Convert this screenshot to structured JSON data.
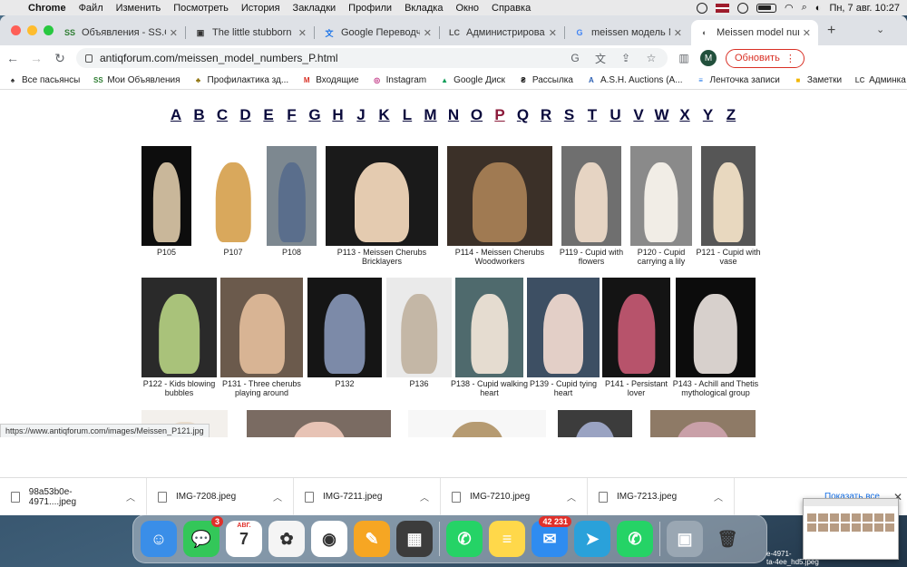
{
  "menubar": {
    "app": "Chrome",
    "items": [
      "Файл",
      "Изменить",
      "Посмотреть",
      "История",
      "Закладки",
      "Профили",
      "Вкладка",
      "Окно",
      "Справка"
    ],
    "clock": "Пн, 7 авг.  10:27"
  },
  "tabs": [
    {
      "icon": "SS",
      "label": "Объявления - SS.COM",
      "color": "#2e7d32"
    },
    {
      "icon": "▣",
      "label": "The little stubborn one,",
      "color": "#333"
    },
    {
      "icon": "文",
      "label": "Google Переводчик",
      "color": "#1a73e8"
    },
    {
      "icon": "LC",
      "label": "Администрирование С",
      "color": "#555"
    },
    {
      "icon": "G",
      "label": "meissen модель № Р 1",
      "color": "#4285f4"
    },
    {
      "icon": "◐",
      "label": "Meissen model number",
      "color": "#555"
    }
  ],
  "toolbar": {
    "url": "antiqforum.com/meissen_model_numbers_P.html",
    "profile_initial": "M",
    "update_label": "Обновить"
  },
  "bookmarks": [
    {
      "icon": "♠",
      "label": "Все пасьянсы",
      "color": "#222"
    },
    {
      "icon": "SS",
      "label": "Мои Объявления",
      "color": "#2e7d32"
    },
    {
      "icon": "♣",
      "label": "Профилактика зд...",
      "color": "#8a6d00"
    },
    {
      "icon": "M",
      "label": "Входящие",
      "color": "#d93025"
    },
    {
      "icon": "◎",
      "label": "Instagram",
      "color": "#c13584"
    },
    {
      "icon": "▲",
      "label": "Google Диск",
      "color": "#0f9d58"
    },
    {
      "icon": "₴",
      "label": "Рассылка",
      "color": "#111"
    },
    {
      "icon": "A",
      "label": "A.S.H. Auctions (A...",
      "color": "#2b5fb3"
    },
    {
      "icon": "≡",
      "label": "Ленточка записи",
      "color": "#1a73e8"
    },
    {
      "icon": "■",
      "label": "Заметки",
      "color": "#f2b600"
    },
    {
      "icon": "LC",
      "label": "Админка",
      "color": "#555"
    }
  ],
  "letters": [
    "A",
    "B",
    "C",
    "D",
    "E",
    "F",
    "G",
    "H",
    "J",
    "K",
    "L",
    "M",
    "N",
    "O",
    "P",
    "Q",
    "R",
    "S",
    "T",
    "U",
    "V",
    "W",
    "X",
    "Y",
    "Z"
  ],
  "current_letter": "P",
  "rows": [
    [
      {
        "caption": "P105",
        "bg": "#0d0d0d",
        "fig": "#c9b79a"
      },
      {
        "caption": "P107",
        "bg": "#ffffff",
        "fig": "#d9a85c"
      },
      {
        "caption": "P108",
        "bg": "#7d8890",
        "fig": "#5a6e8c"
      },
      {
        "caption": "P113 - Meissen Cherubs Bricklayers",
        "bg": "#1a1a1a",
        "fig": "#e4cbb0"
      },
      {
        "caption": "P114 - Meissen Cherubs Woodworkers",
        "bg": "#3b3028",
        "fig": "#a07a52"
      },
      {
        "caption": "P119 - Cupid with flowers",
        "bg": "#6f6f6f",
        "fig": "#e6d4c3"
      },
      {
        "caption": "P120 - Cupid carrying a lily",
        "bg": "#8a8a8a",
        "fig": "#f1ede6"
      },
      {
        "caption": "P121 - Cupid with vase",
        "bg": "#565656",
        "fig": "#e8d8bf"
      }
    ],
    [
      {
        "caption": "P122 - Kids blowing bubbles",
        "bg": "#2a2a2a",
        "fig": "#a9c27a"
      },
      {
        "caption": "P131 - Three cherubs playing around",
        "bg": "#6b5a4c",
        "fig": "#d8b494"
      },
      {
        "caption": "P132",
        "bg": "#151515",
        "fig": "#7c8aa8"
      },
      {
        "caption": "P136",
        "bg": "#eaeaea",
        "fig": "#c4b7a6"
      },
      {
        "caption": "P138 - Cupid walking heart",
        "bg": "#4f6a6d",
        "fig": "#e5dcd0"
      },
      {
        "caption": "P139 - Cupid tying heart",
        "bg": "#3d4f63",
        "fig": "#e3cfc7"
      },
      {
        "caption": "P141 - Persistant lover",
        "bg": "#141414",
        "fig": "#b7536b"
      },
      {
        "caption": "P143 - Achill and Thetis mythological group",
        "bg": "#0c0c0c",
        "fig": "#d7d0cc"
      }
    ],
    [
      {
        "caption": "",
        "bg": "#f3f0ec",
        "fig": "#e9dccc"
      },
      {
        "caption": "",
        "bg": "#7a6b62",
        "fig": "#e7c3b5"
      },
      {
        "caption": "",
        "bg": "#f7f7f7",
        "fig": "#b69b72"
      },
      {
        "caption": "",
        "bg": "#3c3c3c",
        "fig": "#9aa3c2"
      },
      {
        "caption": "",
        "bg": "#8e7a66",
        "fig": "#c9a0a8"
      }
    ]
  ],
  "status_url": "https://www.antiqforum.com/images/Meissen_P121.jpg",
  "downloads": [
    "98a53b0e-4971....jpeg",
    "IMG-7208.jpeg",
    "IMG-7211.jpeg",
    "IMG-7210.jpeg",
    "IMG-7213.jpeg"
  ],
  "downloads_show_all": "Показать все",
  "dock": [
    {
      "name": "finder",
      "glyph": "☺",
      "bg": "#3a8ee8"
    },
    {
      "name": "messages",
      "glyph": "💬",
      "bg": "#33c759",
      "badge": "3"
    },
    {
      "name": "calendar",
      "glyph": "7",
      "bg": "#ffffff",
      "sub": "АВГ."
    },
    {
      "name": "photos",
      "glyph": "✿",
      "bg": "#f4f4f4"
    },
    {
      "name": "chrome",
      "glyph": "◉",
      "bg": "#ffffff"
    },
    {
      "name": "pages",
      "glyph": "✎",
      "bg": "#f6a623"
    },
    {
      "name": "calculator",
      "glyph": "▦",
      "bg": "#3c3c3c"
    },
    {
      "name": "whatsapp",
      "glyph": "✆",
      "bg": "#25d366"
    },
    {
      "name": "notes",
      "glyph": "≡",
      "bg": "#ffd84a"
    },
    {
      "name": "mail",
      "glyph": "✉",
      "bg": "#2f8cf0",
      "badge": "42 231"
    },
    {
      "name": "telegram",
      "glyph": "➤",
      "bg": "#2aa1da"
    },
    {
      "name": "whatsapp-2",
      "glyph": "✆",
      "bg": "#25d366"
    },
    {
      "name": "preview",
      "glyph": "▣",
      "bg": "#9aa7b3"
    },
    {
      "name": "trash",
      "glyph": "🗑",
      "bg": "transparent"
    }
  ],
  "desktop_labels": [
    "e-4971-",
    "ta-4ee_hd5.jpeg"
  ]
}
